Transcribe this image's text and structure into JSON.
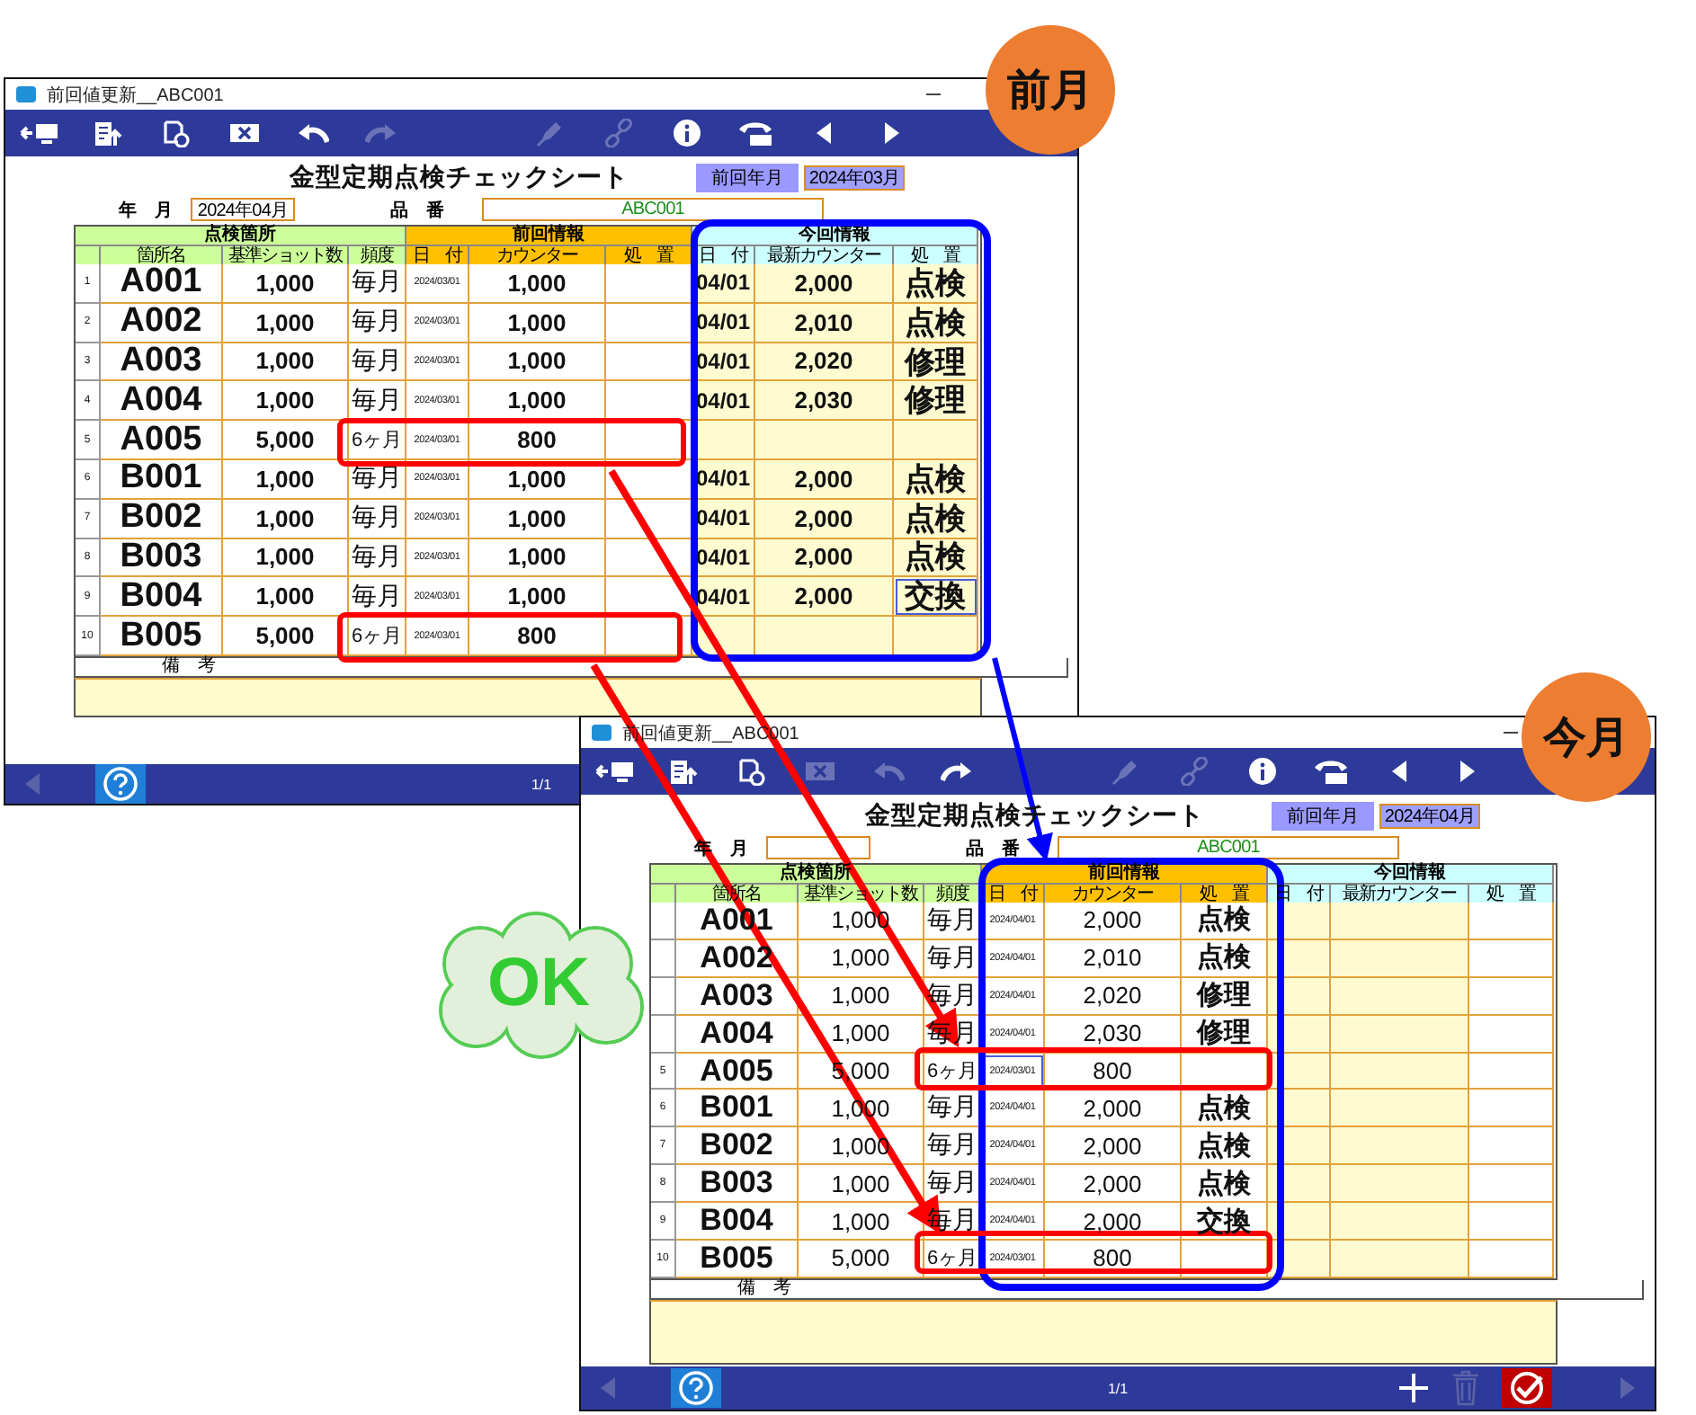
{
  "annotations": {
    "badges": [
      {
        "label": "前月"
      },
      {
        "label": "今月"
      }
    ],
    "cloud": {
      "label": "OK"
    }
  },
  "windows": [
    {
      "title": "前回値更新__ABC001",
      "toolbar": [
        {
          "kind": "exit",
          "disabled": false
        },
        {
          "kind": "upload",
          "disabled": false
        },
        {
          "kind": "copy",
          "disabled": false
        },
        {
          "kind": "delete",
          "disabled": false
        },
        {
          "kind": "undo",
          "disabled": false
        },
        {
          "kind": "redo",
          "disabled": true
        },
        {
          "kind": "pen",
          "disabled": true
        },
        {
          "kind": "link",
          "disabled": true
        },
        {
          "kind": "info",
          "disabled": false
        },
        {
          "kind": "phone",
          "disabled": false
        },
        {
          "kind": "prev",
          "disabled": false
        },
        {
          "kind": "next",
          "disabled": false
        }
      ],
      "sheet": {
        "title": "金型定期点検チェックシート",
        "prev_month_label": "前回年月",
        "prev_month_value": "2024年03月",
        "month_label": "年　月",
        "month_value": "2024年04月",
        "part_label": "品　番",
        "part_value": "ABC001"
      },
      "groups": [
        "点検箇所",
        "前回情報",
        "今回情報"
      ],
      "columns": [
        "箇所名",
        "基準ショット数",
        "頻度",
        "日　付",
        "カウンター",
        "処　置",
        "日　付",
        "最新カウンター",
        "処　置"
      ],
      "rows": [
        {
          "no": "1",
          "name": "A001",
          "base": "1,000",
          "freq": "毎月",
          "prev_date": "2024/03/01",
          "prev_counter": "1,000",
          "cur_date": "04/01",
          "cur_counter": "2,000",
          "cur_action": "点検",
          "action_focused": false
        },
        {
          "no": "2",
          "name": "A002",
          "base": "1,000",
          "freq": "毎月",
          "prev_date": "2024/03/01",
          "prev_counter": "1,000",
          "cur_date": "04/01",
          "cur_counter": "2,010",
          "cur_action": "点検",
          "action_focused": false
        },
        {
          "no": "3",
          "name": "A003",
          "base": "1,000",
          "freq": "毎月",
          "prev_date": "2024/03/01",
          "prev_counter": "1,000",
          "cur_date": "04/01",
          "cur_counter": "2,020",
          "cur_action": "修理",
          "action_focused": false
        },
        {
          "no": "4",
          "name": "A004",
          "base": "1,000",
          "freq": "毎月",
          "prev_date": "2024/03/01",
          "prev_counter": "1,000",
          "cur_date": "04/01",
          "cur_counter": "2,030",
          "cur_action": "修理",
          "action_focused": false
        },
        {
          "no": "5",
          "name": "A005",
          "base": "5,000",
          "freq": "6ヶ月",
          "prev_date": "2024/03/01",
          "prev_counter": "800",
          "action_focused": false
        },
        {
          "no": "6",
          "name": "B001",
          "base": "1,000",
          "freq": "毎月",
          "prev_date": "2024/03/01",
          "prev_counter": "1,000",
          "cur_date": "04/01",
          "cur_counter": "2,000",
          "cur_action": "点検",
          "action_focused": false
        },
        {
          "no": "7",
          "name": "B002",
          "base": "1,000",
          "freq": "毎月",
          "prev_date": "2024/03/01",
          "prev_counter": "1,000",
          "cur_date": "04/01",
          "cur_counter": "2,000",
          "cur_action": "点検",
          "action_focused": false
        },
        {
          "no": "8",
          "name": "B003",
          "base": "1,000",
          "freq": "毎月",
          "prev_date": "2024/03/01",
          "prev_counter": "1,000",
          "cur_date": "04/01",
          "cur_counter": "2,000",
          "cur_action": "点検",
          "action_focused": false
        },
        {
          "no": "9",
          "name": "B004",
          "base": "1,000",
          "freq": "毎月",
          "prev_date": "2024/03/01",
          "prev_counter": "1,000",
          "cur_date": "04/01",
          "cur_counter": "2,000",
          "cur_action": "交換",
          "action_focused": true
        },
        {
          "no": "10",
          "name": "B005",
          "base": "5,000",
          "freq": "6ヶ月",
          "prev_date": "2024/03/01",
          "prev_counter": "800",
          "action_focused": false
        }
      ],
      "remarks_label": "備　考",
      "footer": {
        "left": [
          {
            "kind": "back",
            "disabled": true
          },
          {
            "kind": "help",
            "disabled": false
          }
        ],
        "page": "1/1"
      }
    },
    {
      "title": "前回値更新__ABC001",
      "toolbar": [
        {
          "kind": "exit",
          "disabled": false
        },
        {
          "kind": "upload",
          "disabled": false
        },
        {
          "kind": "copy",
          "disabled": false
        },
        {
          "kind": "delete",
          "disabled": true
        },
        {
          "kind": "undo",
          "disabled": true
        },
        {
          "kind": "redo",
          "disabled": false
        },
        {
          "kind": "pen",
          "disabled": true
        },
        {
          "kind": "link",
          "disabled": true
        },
        {
          "kind": "info",
          "disabled": false
        },
        {
          "kind": "phone",
          "disabled": false
        },
        {
          "kind": "prev",
          "disabled": false
        },
        {
          "kind": "next",
          "disabled": false
        }
      ],
      "sheet": {
        "title": "金型定期点検チェックシート",
        "prev_month_label": "前回年月",
        "prev_month_value": "2024年04月",
        "month_label": "年　月",
        "part_label": "品　番",
        "part_value": "ABC001"
      },
      "groups": [
        "点検箇所",
        "前回情報",
        "今回情報"
      ],
      "columns": [
        "箇所名",
        "基準ショット数",
        "頻度",
        "日　付",
        "カウンター",
        "処　置",
        "日　付",
        "最新カウンター",
        "処　置"
      ],
      "rows": [
        {
          "name": "A001",
          "base": "1,000",
          "freq": "毎月",
          "prev_date": "2024/04/01",
          "prev_counter": "2,000",
          "prev_action": "点検",
          "date_focused": false
        },
        {
          "name": "A002",
          "base": "1,000",
          "freq": "毎月",
          "prev_date": "2024/04/01",
          "prev_counter": "2,010",
          "prev_action": "点検",
          "date_focused": false
        },
        {
          "name": "A003",
          "base": "1,000",
          "freq": "毎月",
          "prev_date": "2024/04/01",
          "prev_counter": "2,020",
          "prev_action": "修理",
          "date_focused": false
        },
        {
          "name": "A004",
          "base": "1,000",
          "freq": "毎月",
          "prev_date": "2024/04/01",
          "prev_counter": "2,030",
          "prev_action": "修理",
          "date_focused": false
        },
        {
          "no": "5",
          "name": "A005",
          "base": "5,000",
          "freq": "6ヶ月",
          "prev_date": "2024/03/01",
          "prev_counter": "800",
          "date_focused": true
        },
        {
          "no": "6",
          "name": "B001",
          "base": "1,000",
          "freq": "毎月",
          "prev_date": "2024/04/01",
          "prev_counter": "2,000",
          "prev_action": "点検",
          "date_focused": false
        },
        {
          "no": "7",
          "name": "B002",
          "base": "1,000",
          "freq": "毎月",
          "prev_date": "2024/04/01",
          "prev_counter": "2,000",
          "prev_action": "点検",
          "date_focused": false
        },
        {
          "no": "8",
          "name": "B003",
          "base": "1,000",
          "freq": "毎月",
          "prev_date": "2024/04/01",
          "prev_counter": "2,000",
          "prev_action": "点検",
          "date_focused": false
        },
        {
          "no": "9",
          "name": "B004",
          "base": "1,000",
          "freq": "毎月",
          "prev_date": "2024/04/01",
          "prev_counter": "2,000",
          "prev_action": "交換",
          "date_focused": false
        },
        {
          "no": "10",
          "name": "B005",
          "base": "5,000",
          "freq": "6ヶ月",
          "prev_date": "2024/03/01",
          "prev_counter": "800",
          "date_focused": false
        }
      ],
      "remarks_label": "備　考",
      "footer": {
        "left": [
          {
            "kind": "back",
            "disabled": true
          },
          {
            "kind": "help",
            "disabled": false
          }
        ],
        "page": "1/1",
        "right": [
          {
            "kind": "add",
            "disabled": false
          },
          {
            "kind": "trash",
            "disabled": true
          },
          {
            "kind": "confirm",
            "disabled": false
          },
          {
            "kind": "forward",
            "disabled": true
          }
        ]
      }
    }
  ]
}
